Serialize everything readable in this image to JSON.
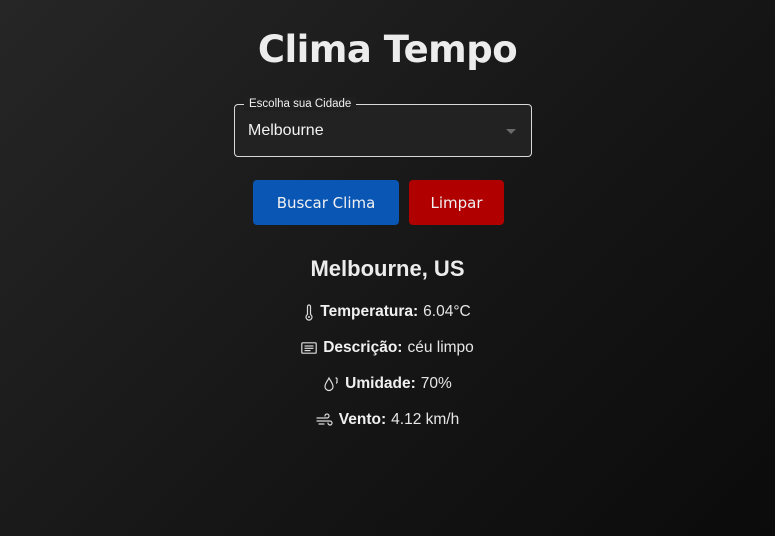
{
  "app": {
    "title": "Clima Tempo"
  },
  "city_select": {
    "label": "Escolha sua Cidade",
    "value": "Melbourne"
  },
  "buttons": {
    "search_label": "Buscar Clima",
    "clear_label": "Limpar"
  },
  "result": {
    "city": "Melbourne, US",
    "temperature": {
      "icon": "thermometer-icon",
      "label": "Temperatura:",
      "value": "6.04°C"
    },
    "description": {
      "icon": "message-icon",
      "label": "Descrição:",
      "value": "céu limpo"
    },
    "humidity": {
      "icon": "droplet-icon",
      "label": "Umidade:",
      "value": "70%"
    },
    "wind": {
      "icon": "wind-icon",
      "label": "Vento:",
      "value": "4.12 km/h"
    }
  },
  "colors": {
    "search_button": "#0a56b5",
    "clear_button": "#b00000"
  }
}
